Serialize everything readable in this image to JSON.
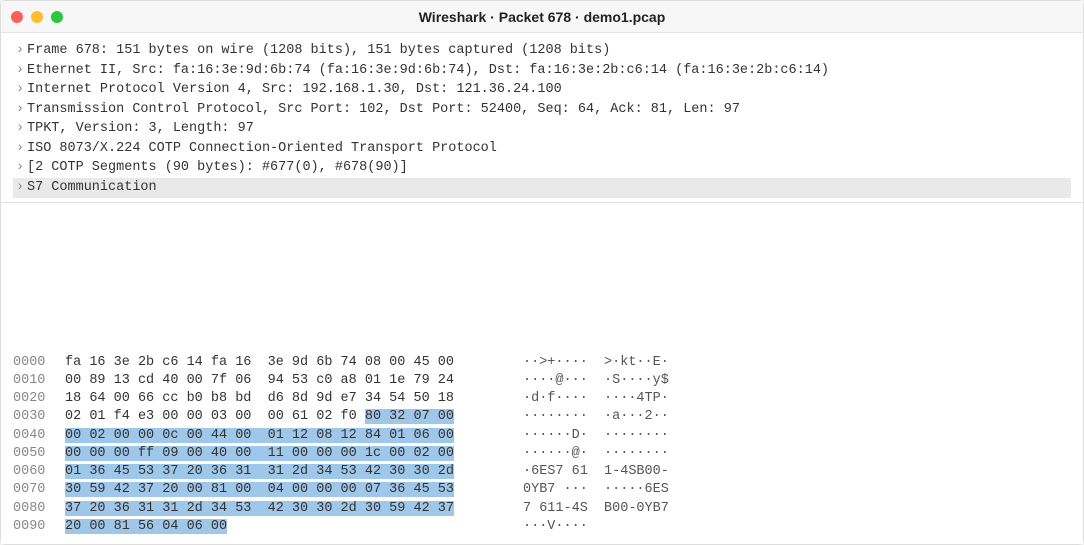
{
  "window": {
    "title": "Wireshark · Packet 678 · demo1.pcap"
  },
  "tree": {
    "rows": [
      {
        "label": "Frame 678: 151 bytes on wire (1208 bits), 151 bytes captured (1208 bits)",
        "selected": false
      },
      {
        "label": "Ethernet II, Src: fa:16:3e:9d:6b:74 (fa:16:3e:9d:6b:74), Dst: fa:16:3e:2b:c6:14 (fa:16:3e:2b:c6:14)",
        "selected": false
      },
      {
        "label": "Internet Protocol Version 4, Src: 192.168.1.30, Dst: 121.36.24.100",
        "selected": false
      },
      {
        "label": "Transmission Control Protocol, Src Port: 102, Dst Port: 52400, Seq: 64, Ack: 81, Len: 97",
        "selected": false
      },
      {
        "label": "TPKT, Version: 3, Length: 97",
        "selected": false
      },
      {
        "label": "ISO 8073/X.224 COTP Connection-Oriented Transport Protocol",
        "selected": false
      },
      {
        "label": "[2 COTP Segments (90 bytes): #677(0), #678(90)]",
        "selected": false
      },
      {
        "label": "S7 Communication",
        "selected": true
      }
    ]
  },
  "hex": {
    "highlight_start_row": 3,
    "highlight_start_byte": 12,
    "highlight_end_row": 9,
    "highlight_end_byte": 6,
    "rows": [
      {
        "offset": "0000",
        "b1": "fa 16 3e 2b c6 14 fa 16",
        "b2": "3e 9d 6b 74 08 00 45 00",
        "ascii": "··>+····  >·kt··E·"
      },
      {
        "offset": "0010",
        "b1": "00 89 13 cd 40 00 7f 06",
        "b2": "94 53 c0 a8 01 1e 79 24",
        "ascii": "····@···  ·S····y$"
      },
      {
        "offset": "0020",
        "b1": "18 64 00 66 cc b0 b8 bd",
        "b2": "d6 8d 9d e7 34 54 50 18",
        "ascii": "·d·f····  ····4TP·"
      },
      {
        "offset": "0030",
        "b1": "02 01 f4 e3 00 00 03 00",
        "b2": "00 61 02 f0 80 32 07 00",
        "ascii": "········  ·a···2··"
      },
      {
        "offset": "0040",
        "b1": "00 02 00 00 0c 00 44 00",
        "b2": "01 12 08 12 84 01 06 00",
        "ascii": "······D·  ········"
      },
      {
        "offset": "0050",
        "b1": "00 00 00 ff 09 00 40 00",
        "b2": "11 00 00 00 1c 00 02 00",
        "ascii": "······@·  ········"
      },
      {
        "offset": "0060",
        "b1": "01 36 45 53 37 20 36 31",
        "b2": "31 2d 34 53 42 30 30 2d",
        "ascii": "·6ES7 61  1-4SB00-"
      },
      {
        "offset": "0070",
        "b1": "30 59 42 37 20 00 81 00",
        "b2": "04 00 00 00 07 36 45 53",
        "ascii": "0YB7 ···  ·····6ES"
      },
      {
        "offset": "0080",
        "b1": "37 20 36 31 31 2d 34 53",
        "b2": "42 30 30 2d 30 59 42 37",
        "ascii": "7 611-4S  B00-0YB7"
      },
      {
        "offset": "0090",
        "b1": "20 00 81 56 04 06 00",
        "b2": "",
        "ascii": "···V····"
      }
    ]
  },
  "glyphs": {
    "twisty_collapsed": "›"
  }
}
